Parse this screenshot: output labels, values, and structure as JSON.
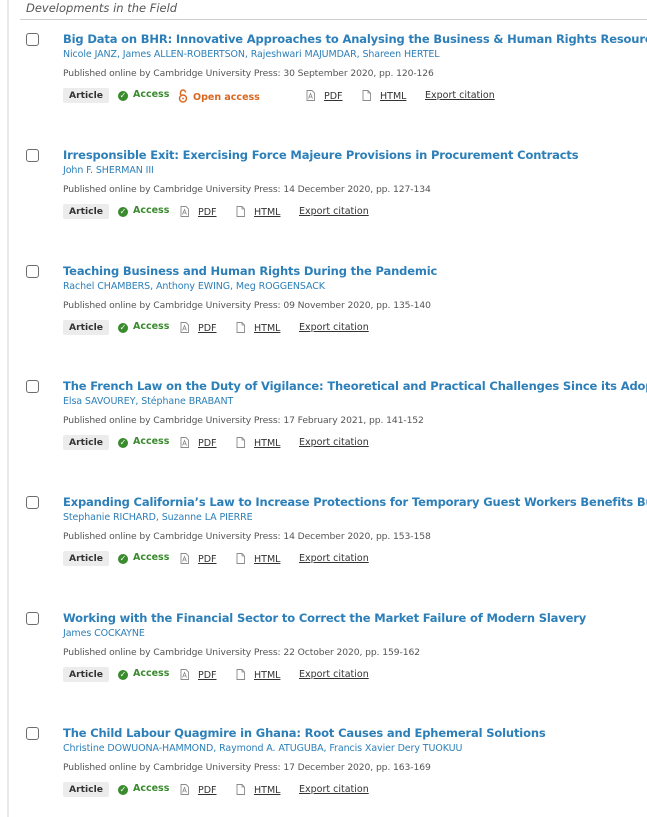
{
  "section": {
    "title": "Developments in the Field"
  },
  "labels": {
    "article": "Article",
    "access": "Access",
    "open_access": "Open access",
    "pdf": "PDF",
    "html": "HTML",
    "export": "Export citation"
  },
  "colors": {
    "title_link": "#2c7fb8",
    "access_green": "#3a8a2e",
    "open_access_orange": "#d9661f",
    "badge_bg": "#ececec"
  },
  "articles": [
    {
      "title": "Big Data on BHR: Innovative Approaches to Analysing the Business & Human Rights Resource Centre Database",
      "authors": [
        "Nicole JANZ",
        "James ALLEN-ROBERTSON",
        "Rajeshwari MAJUMDAR",
        "Shareen HERTEL"
      ],
      "published": "Published online by Cambridge University Press: 30 September 2020, pp. 120-126",
      "open_access": true
    },
    {
      "title": "Irresponsible Exit: Exercising Force Majeure Provisions in Procurement Contracts",
      "authors": [
        "John F. SHERMAN III"
      ],
      "published": "Published online by Cambridge University Press: 14 December 2020, pp. 127-134",
      "open_access": false
    },
    {
      "title": "Teaching Business and Human Rights During the Pandemic",
      "authors": [
        "Rachel CHAMBERS",
        "Anthony EWING",
        "Meg ROGGENSACK"
      ],
      "published": "Published online by Cambridge University Press: 09 November 2020, pp. 135-140",
      "open_access": false
    },
    {
      "title": "The French Law on the Duty of Vigilance: Theoretical and Practical Challenges Since its Adoption",
      "authors": [
        "Elsa SAVOUREY",
        "Stéphane BRABANT"
      ],
      "published": "Published online by Cambridge University Press: 17 February 2021, pp. 141-152",
      "open_access": false
    },
    {
      "title": "Expanding California’s Law to Increase Protections for Temporary Guest Workers Benefits Businesses",
      "authors": [
        "Stephanie RICHARD",
        "Suzanne LA PIERRE"
      ],
      "published": "Published online by Cambridge University Press: 14 December 2020, pp. 153-158",
      "open_access": false
    },
    {
      "title": "Working with the Financial Sector to Correct the Market Failure of Modern Slavery",
      "authors": [
        "James COCKAYNE"
      ],
      "published": "Published online by Cambridge University Press: 22 October 2020, pp. 159-162",
      "open_access": false
    },
    {
      "title": "The Child Labour Quagmire in Ghana: Root Causes and Ephemeral Solutions",
      "authors": [
        "Christine DOWUONA-HAMMOND",
        "Raymond A. ATUGUBA",
        "Francis Xavier Dery TUOKUU"
      ],
      "published": "Published online by Cambridge University Press: 17 December 2020, pp. 163-169",
      "open_access": false
    }
  ]
}
